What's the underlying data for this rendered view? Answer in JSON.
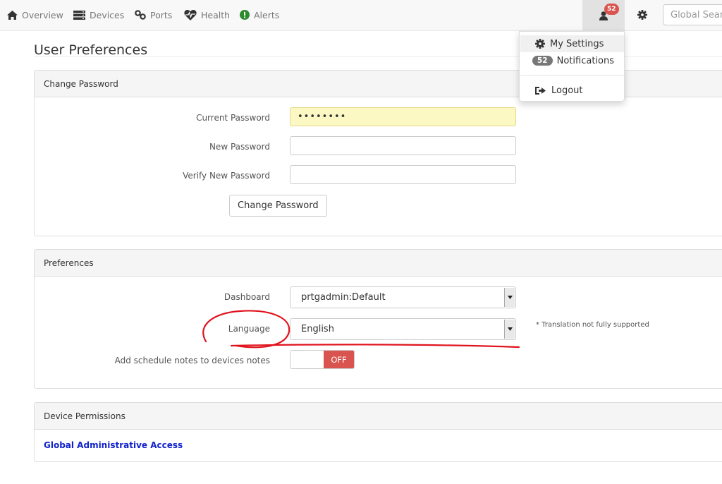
{
  "nav": {
    "items": [
      {
        "label": "Overview",
        "icon": "home-icon"
      },
      {
        "label": "Devices",
        "icon": "server-icon"
      },
      {
        "label": "Ports",
        "icon": "link-icon"
      },
      {
        "label": "Health",
        "icon": "heartbeat-icon"
      },
      {
        "label": "Alerts",
        "icon": "alert-icon"
      }
    ],
    "user_badge": "52",
    "search_placeholder": "Global Search"
  },
  "page": {
    "title": "User Preferences"
  },
  "change_password": {
    "heading": "Change Password",
    "current_label": "Current Password",
    "current_value": "••••••••",
    "new_label": "New Password",
    "new_value": "",
    "verify_label": "Verify New Password",
    "verify_value": "",
    "button": "Change Password"
  },
  "preferences": {
    "heading": "Preferences",
    "dashboard_label": "Dashboard",
    "dashboard_value": "prtgadmin:Default",
    "language_label": "Language",
    "language_value": "English",
    "language_note": "* Translation not fully supported",
    "schedule_label": "Add schedule notes to devices notes",
    "schedule_state": "OFF"
  },
  "device_permissions": {
    "heading": "Device Permissions",
    "access": "Global Administrative Access"
  },
  "user_menu": {
    "settings": "My Settings",
    "notifications_badge": "52",
    "notifications": "Notifications",
    "logout": "Logout"
  },
  "colors": {
    "danger": "#d9534f",
    "link": "#1122cc",
    "annotation": "#e0141e",
    "autofill": "#fcf8c3"
  }
}
